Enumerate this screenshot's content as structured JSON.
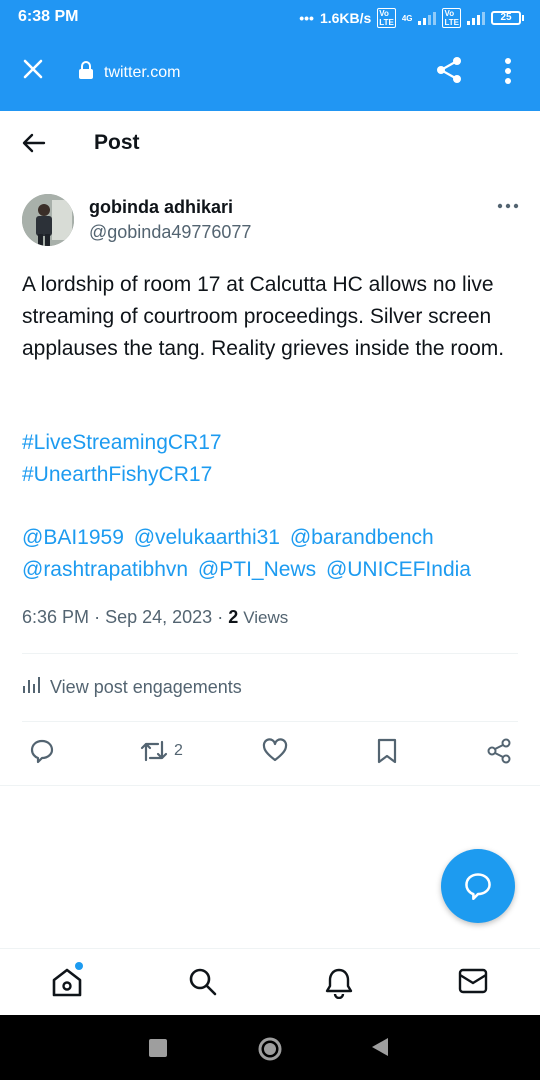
{
  "status_bar": {
    "time": "6:38 PM",
    "speed": "1.6KB/s",
    "network": "4G",
    "volte": "Vo LTE",
    "battery": "25"
  },
  "browser": {
    "url": "twitter.com",
    "icons": [
      "close-icon",
      "lock-icon",
      "share-icon",
      "more-vertical-icon"
    ]
  },
  "header": {
    "title": "Post"
  },
  "author": {
    "name": "gobinda adhikari",
    "handle": "@gobinda49776077"
  },
  "tweet": {
    "text": "A lordship of room 17 at Calcutta HC allows no live streaming of courtroom proceedings. Silver screen applauses the tang. Reality grieves inside the room.",
    "hashtags": [
      "#LiveStreamingCR17",
      "#UnearthFishyCR17"
    ],
    "mentions": [
      "@BAI1959",
      "@velukaarthi31",
      "@barandbench",
      "@rashtrapatibhvn",
      "@PTI_News",
      "@UNICEFIndia"
    ],
    "time": "6:36 PM",
    "date": "Sep 24, 2023",
    "views_count": "2",
    "views_label": "Views"
  },
  "engagements": {
    "label": "View post engagements"
  },
  "actions": {
    "reply_count": "",
    "repost_count": "2",
    "like_count": ""
  },
  "colors": {
    "chrome": "#2196f3",
    "link": "#1d9bf0",
    "secondary_text": "#536471"
  }
}
